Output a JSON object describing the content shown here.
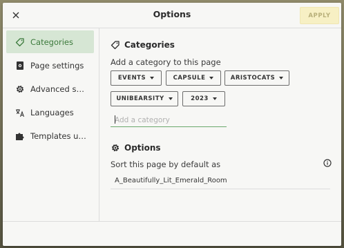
{
  "dialog": {
    "title": "Options",
    "apply_label": "APPLY"
  },
  "sidebar": {
    "items": [
      {
        "label": "Categories",
        "icon": "tag-icon",
        "active": true
      },
      {
        "label": "Page settings",
        "icon": "page-settings-icon",
        "active": false
      },
      {
        "label": "Advanced settings",
        "icon": "gear-icon",
        "active": false
      },
      {
        "label": "Languages",
        "icon": "translate-icon",
        "active": false
      },
      {
        "label": "Templates used",
        "icon": "puzzle-icon",
        "active": false
      }
    ]
  },
  "categories": {
    "title": "Categories",
    "subtitle": "Add a category to this page",
    "chips": [
      "EVENTS",
      "CAPSULE",
      "ARISTOCATS",
      "UNIBEARSITY",
      "2023"
    ],
    "input_placeholder": "Add a category"
  },
  "options": {
    "title": "Options",
    "sort_label": "Sort this page by default as",
    "sort_value": "A_Beautifully_Lit_Emerald_Room"
  },
  "colors": {
    "accent": "#3c7a3c",
    "active_bg": "#d6e6d4",
    "apply_bg": "#f7f0c4"
  }
}
